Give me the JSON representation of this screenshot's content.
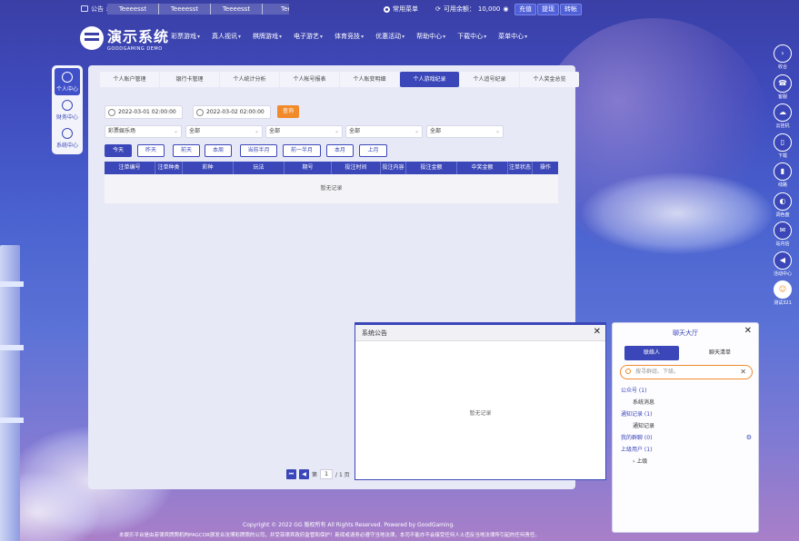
{
  "topbar": {
    "notice_label": "公告 :",
    "marquee": [
      "Teeeesst",
      "Teeeesst",
      "Teeeesst",
      "Teee"
    ],
    "favorite": "常用菜单",
    "balance_label": "可用余额：",
    "balance_value": "10,000",
    "buttons": [
      "充值",
      "提现",
      "转帐"
    ]
  },
  "logo": {
    "cn": "演示系统",
    "en": "GOODGAMING DEMO"
  },
  "nav": [
    "彩票游戏",
    "真人视讯",
    "棋牌游戏",
    "电子游艺",
    "体育竞技",
    "优惠活动",
    "帮助中心",
    "下载中心",
    "菜单中心"
  ],
  "left_menu": [
    "个人中心",
    "财务中心",
    "系统中心"
  ],
  "tabs": [
    "个人账户管理",
    "银行卡管理",
    "个人统计分析",
    "个人帐号报表",
    "个人账变明细",
    "个人游戏纪录",
    "个人追号纪录",
    "个人奖金总览"
  ],
  "active_tab_index": 5,
  "filters": {
    "date_start": "2022-03-01 02:00:00",
    "date_end": "2022-03-02 02:00:00",
    "query_label": "查询",
    "selects": [
      "彩票娱乐场",
      "全部",
      "全部",
      "全部",
      "全部"
    ]
  },
  "ranges": [
    "今天",
    "昨天",
    "前天",
    "本周",
    "当前半月",
    "前一半月",
    "本月",
    "上月"
  ],
  "active_range_index": 0,
  "table": {
    "headers": [
      "注单编号",
      "注单种类",
      "彩种",
      "玩法",
      "期号",
      "投注时间",
      "投注内容",
      "投注金额",
      "中奖金额",
      "注单状态",
      "操作"
    ],
    "empty_text": "暂无记录"
  },
  "pager": {
    "prefix": "第",
    "page": "1",
    "suffix": "/ 1 页"
  },
  "notice_popup": {
    "title": "系统公告",
    "empty_text": "暂无记录"
  },
  "chat": {
    "title": "聊天大厅",
    "tabs": [
      "联络人",
      "聊天清单"
    ],
    "search_placeholder": "搜寻群组、下级。",
    "list": [
      {
        "label": "公众号 (1)",
        "sub": false
      },
      {
        "label": "系统消息",
        "sub": true
      },
      {
        "label": "通知记录 (1)",
        "sub": false
      },
      {
        "label": "通知记录",
        "sub": true
      },
      {
        "label": "我的群聊 (0)",
        "sub": false
      },
      {
        "label": "上级用户 (1)",
        "sub": false
      },
      {
        "label": "› 上级",
        "sub": true
      }
    ]
  },
  "rail": [
    "收合",
    "客服",
    "云挂机",
    "下载",
    "线路",
    "调色盘",
    "站内信",
    "活动中心",
    "测试321"
  ],
  "footer": {
    "copyright": "Copyright © 2022 GG 版权所有 All Rights Reserved. Powered by GoodGaming.",
    "disclaimer": "本娱乐平台是由菲律宾牌照机构PAGCOR颁发合法博彩牌照的公司，并受菲律宾政府监管和保护！新闻或请务必遵守当地法律，本司不能亦不会接受任何人士违反当地法律所引起的任何责任。"
  }
}
